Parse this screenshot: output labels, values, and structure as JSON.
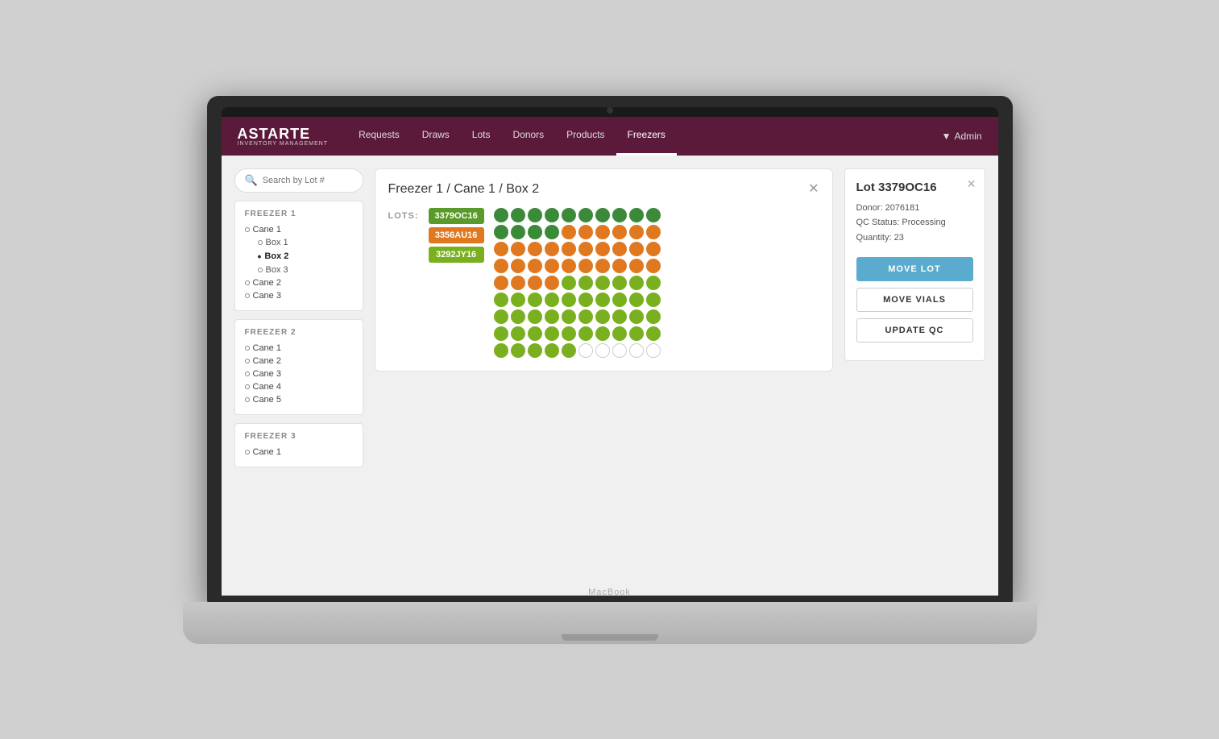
{
  "nav": {
    "logo_text": "ASTARTE",
    "logo_sub": "INVENTORY MANAGEMENT",
    "items": [
      {
        "label": "Requests",
        "active": false
      },
      {
        "label": "Draws",
        "active": false
      },
      {
        "label": "Lots",
        "active": false
      },
      {
        "label": "Donors",
        "active": false
      },
      {
        "label": "Products",
        "active": false
      },
      {
        "label": "Freezers",
        "active": true
      }
    ],
    "admin_label": "Admin"
  },
  "sidebar": {
    "search_placeholder": "Search by Lot #",
    "freezers": [
      {
        "title": "FREEZER 1",
        "canes": [
          {
            "label": "Cane 1",
            "boxes": [
              "Box 1",
              "Box 2",
              "Box 3"
            ]
          },
          {
            "label": "Cane 2"
          },
          {
            "label": "Cane 3"
          }
        ]
      },
      {
        "title": "FREEZER 2",
        "canes": [
          {
            "label": "Cane 1"
          },
          {
            "label": "Cane 2"
          },
          {
            "label": "Cane 3"
          },
          {
            "label": "Cane 4"
          },
          {
            "label": "Cane 5"
          }
        ]
      },
      {
        "title": "FREEZER 3",
        "canes": [
          {
            "label": "Cane 1"
          }
        ]
      }
    ]
  },
  "box_modal": {
    "title": "Freezer 1 / Cane 1 / Box 2",
    "lots_label": "LOTS:",
    "lots": [
      {
        "id": "3379OC16",
        "color": "green"
      },
      {
        "id": "3356AU16",
        "color": "orange"
      },
      {
        "id": "3292JY16",
        "color": "yellow-green"
      }
    ]
  },
  "lot_detail": {
    "title": "Lot 3379OC16",
    "donor": "Donor: 2076181",
    "qc_status": "QC Status: Processing",
    "quantity": "Quantity: 23",
    "buttons": [
      {
        "label": "MOVE LOT",
        "style": "primary"
      },
      {
        "label": "MOVE VIALS",
        "style": "secondary"
      },
      {
        "label": "UPDATE QC",
        "style": "secondary"
      }
    ]
  },
  "macbook_label": "MacBook",
  "vials": {
    "rows": [
      [
        "green",
        "green",
        "green",
        "green",
        "green",
        "green",
        "green",
        "green",
        "green",
        "green"
      ],
      [
        "green",
        "green",
        "green",
        "green",
        "orange",
        "orange",
        "orange",
        "orange",
        "orange",
        "orange"
      ],
      [
        "orange",
        "orange",
        "orange",
        "orange",
        "orange",
        "orange",
        "orange",
        "orange",
        "orange",
        "orange"
      ],
      [
        "orange",
        "orange",
        "orange",
        "orange",
        "orange",
        "orange",
        "orange",
        "orange",
        "orange",
        "orange"
      ],
      [
        "orange",
        "orange",
        "orange",
        "orange",
        "yellow-green",
        "yellow-green",
        "yellow-green",
        "yellow-green",
        "yellow-green",
        "yellow-green"
      ],
      [
        "yellow-green",
        "yellow-green",
        "yellow-green",
        "yellow-green",
        "yellow-green",
        "yellow-green",
        "yellow-green",
        "yellow-green",
        "yellow-green",
        "yellow-green"
      ],
      [
        "yellow-green",
        "yellow-green",
        "yellow-green",
        "yellow-green",
        "yellow-green",
        "yellow-green",
        "yellow-green",
        "yellow-green",
        "yellow-green",
        "yellow-green"
      ],
      [
        "yellow-green",
        "yellow-green",
        "yellow-green",
        "yellow-green",
        "yellow-green",
        "yellow-green",
        "yellow-green",
        "yellow-green",
        "yellow-green",
        "yellow-green"
      ],
      [
        "yellow-green",
        "yellow-green",
        "yellow-green",
        "yellow-green",
        "yellow-green",
        "empty",
        "empty",
        "empty",
        "empty",
        "empty"
      ]
    ]
  }
}
